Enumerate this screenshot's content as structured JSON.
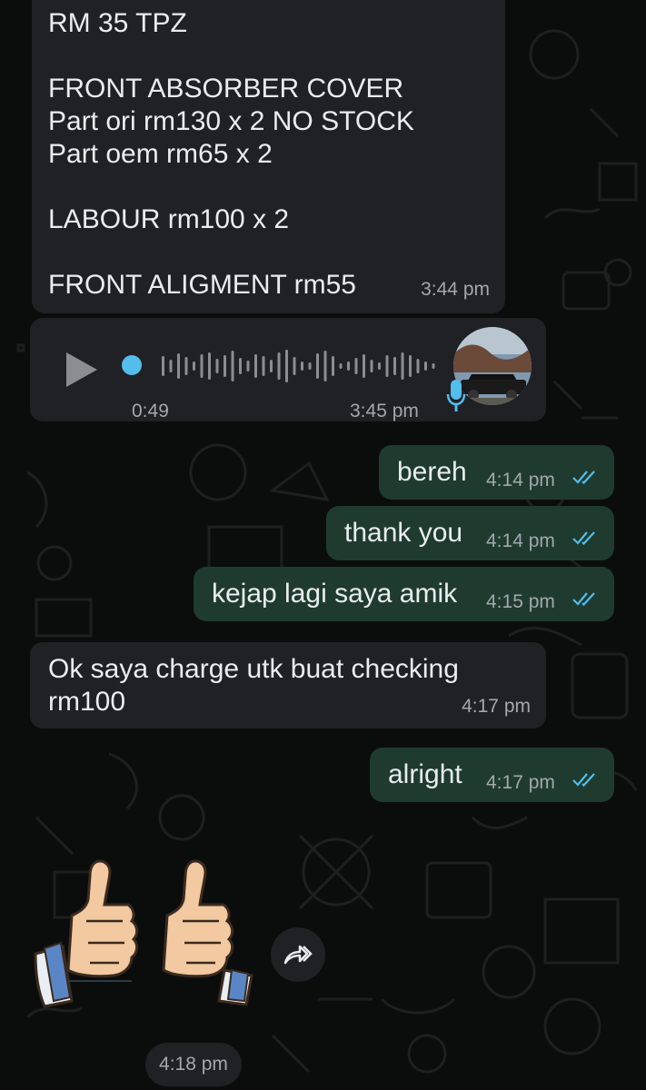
{
  "messages": {
    "m1": {
      "text": "RM 35 TPZ\n\nFRONT ABSORBER COVER\nPart ori rm130 x 2 NO STOCK\nPart oem rm65 x 2\n\nLABOUR rm100 x 2\n\nFRONT ALIGMENT rm55",
      "time": "3:44 pm"
    },
    "voice_note": {
      "duration": "0:49",
      "time": "3:45 pm",
      "progress": 0
    },
    "m3": {
      "text": "bereh",
      "time": "4:14 pm"
    },
    "m4": {
      "text": "thank you",
      "time": "4:14 pm"
    },
    "m5": {
      "text": "kejap lagi saya amik",
      "time": "4:15 pm"
    },
    "m6": {
      "text": "Ok saya charge utk buat checking\nrm100",
      "time": "4:17 pm"
    },
    "m7": {
      "text": "alright",
      "time": "4:17 pm"
    },
    "sticker": {
      "icon": "thumbs-up-sticker",
      "time": "4:18 pm"
    }
  },
  "colors": {
    "incoming_bubble": "#1f2125",
    "outgoing_bubble": "#1f3b2f",
    "read_ticks": "#53bdeb",
    "voice_dot": "#53bdeb"
  },
  "icons": {
    "play": "play-icon",
    "mic": "mic-icon",
    "read_receipt": "double-check-icon",
    "forward": "forward-icon"
  }
}
